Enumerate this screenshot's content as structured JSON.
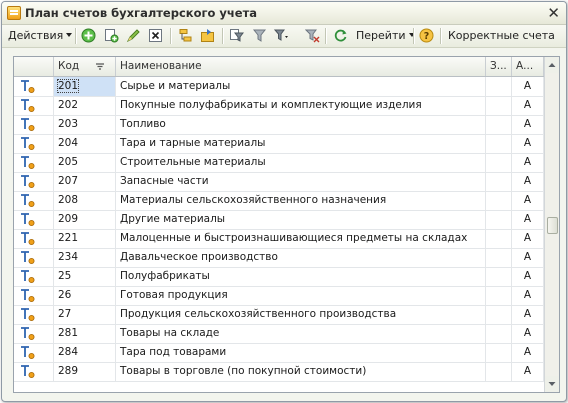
{
  "window": {
    "title": "План счетов бухгалтерского учета",
    "close_glyph": "✕"
  },
  "toolbar": {
    "actions_label": "Действия",
    "goto_label": "Перейти",
    "correct_accounts_label": "Корректные счета"
  },
  "columns": {
    "code": "Код",
    "name": "Наименование",
    "z": "З...",
    "a": "А..."
  },
  "rows": [
    {
      "code": "201",
      "name": "Сырье и материалы",
      "a": "А",
      "selected": true
    },
    {
      "code": "202",
      "name": "Покупные полуфабрикаты и комплектующие изделия",
      "a": "А"
    },
    {
      "code": "203",
      "name": "Топливо",
      "a": "А"
    },
    {
      "code": "204",
      "name": "Тара и тарные материалы",
      "a": "А"
    },
    {
      "code": "205",
      "name": "Строительные материалы",
      "a": "А"
    },
    {
      "code": "207",
      "name": "Запасные части",
      "a": "А"
    },
    {
      "code": "208",
      "name": "Материалы сельскохозяйственного назначения",
      "a": "А"
    },
    {
      "code": "209",
      "name": "Другие материалы",
      "a": "А"
    },
    {
      "code": "221",
      "name": "Малоценные и быстроизнашивающиеся предметы на складах",
      "a": "А"
    },
    {
      "code": "234",
      "name": "Давальческое производство",
      "a": "А"
    },
    {
      "code": "25",
      "name": "Полуфабрикаты",
      "a": "А"
    },
    {
      "code": "26",
      "name": "Готовая продукция",
      "a": "А"
    },
    {
      "code": "27",
      "name": "Продукция сельскохозяйственного производства",
      "a": "А"
    },
    {
      "code": "281",
      "name": "Товары на складе",
      "a": "А"
    },
    {
      "code": "284",
      "name": "Тара под товарами",
      "a": "А"
    },
    {
      "code": "289",
      "name": "Товары в торговле (по покупной стоимости)",
      "a": "А"
    }
  ],
  "icons": {
    "row_icon": "account-icon",
    "toolbar": [
      "add-icon",
      "copy-icon",
      "edit-icon",
      "mark-delete-icon",
      "delete-icon",
      "hierarchy-icon",
      "move-to-group-icon",
      "filter-icon",
      "filter-by-value-icon",
      "filter-dropdown-icon",
      "clear-filter-icon",
      "refresh-icon",
      "help-icon"
    ]
  },
  "colors": {
    "selection": "#cfe1f6",
    "accent_green": "#3aa33a",
    "accent_orange": "#f0a019"
  }
}
